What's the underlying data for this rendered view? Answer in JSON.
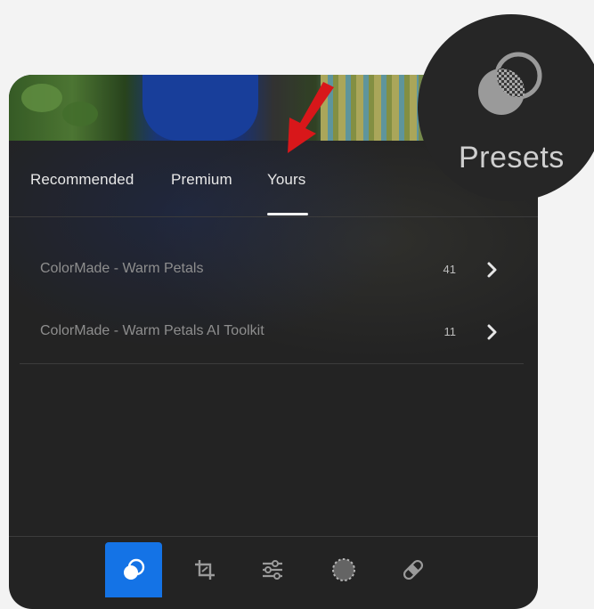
{
  "tabs": [
    {
      "label": "Recommended"
    },
    {
      "label": "Premium"
    },
    {
      "label": "Yours"
    }
  ],
  "active_tab": "Yours",
  "preset_groups": [
    {
      "name": "ColorMade - Warm Petals",
      "count": "41"
    },
    {
      "name": "ColorMade - Warm Petals AI Toolkit",
      "count": "11"
    }
  ],
  "badge": {
    "label": "Presets",
    "icon": "presets-icon"
  },
  "toolbar": {
    "tools": [
      {
        "name": "presets",
        "icon": "presets-icon",
        "active": true
      },
      {
        "name": "crop",
        "icon": "crop-icon",
        "active": false
      },
      {
        "name": "edit",
        "icon": "sliders-icon",
        "active": false
      },
      {
        "name": "mask",
        "icon": "mask-icon",
        "active": false
      },
      {
        "name": "heal",
        "icon": "bandage-icon",
        "active": false
      }
    ]
  },
  "colors": {
    "accent": "#1473e6",
    "panel": "#232323",
    "annotation_arrow": "#d8171a"
  }
}
